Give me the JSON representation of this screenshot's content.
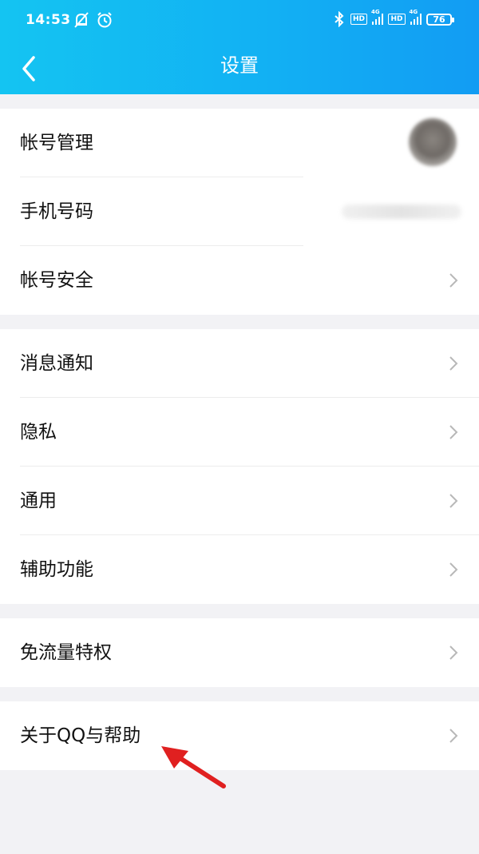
{
  "status_bar": {
    "time": "14:53",
    "hd_label": "HD",
    "network_label": "4G",
    "battery": "76"
  },
  "header": {
    "title": "设置",
    "back_icon": "chevron-left-icon"
  },
  "groups": [
    {
      "items": [
        {
          "label": "帐号管理",
          "accessory": "avatar-blurred"
        },
        {
          "label": "手机号码",
          "accessory": "value-blurred"
        },
        {
          "label": "帐号安全",
          "accessory": "chevron-right-icon"
        }
      ]
    },
    {
      "items": [
        {
          "label": "消息通知",
          "accessory": "chevron-right-icon"
        },
        {
          "label": "隐私",
          "accessory": "chevron-right-icon"
        },
        {
          "label": "通用",
          "accessory": "chevron-right-icon"
        },
        {
          "label": "辅助功能",
          "accessory": "chevron-right-icon"
        }
      ]
    },
    {
      "items": [
        {
          "label": "免流量特权",
          "accessory": "chevron-right-icon"
        }
      ]
    },
    {
      "items": [
        {
          "label": "关于QQ与帮助",
          "accessory": "chevron-right-icon"
        }
      ]
    }
  ],
  "colors": {
    "header_gradient_start": "#14c4f2",
    "header_gradient_end": "#129cf3",
    "annotation_arrow": "#e02020"
  }
}
